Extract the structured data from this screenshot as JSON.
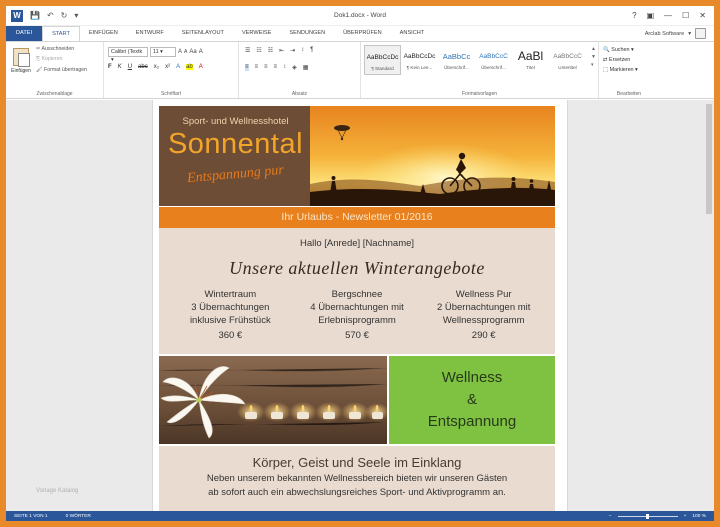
{
  "window": {
    "title": "Dok1.docx - Word",
    "controls": [
      "?",
      "▣",
      "—",
      "☐",
      "✕"
    ]
  },
  "qat": {
    "app_letter": "W",
    "save": "💾",
    "undo": "↶",
    "redo": "↻",
    "more": "▾"
  },
  "tabs": [
    "DATEI",
    "START",
    "EINFÜGEN",
    "ENTWURF",
    "SEITENLAYOUT",
    "VERWEISE",
    "SENDUNGEN",
    "ÜBERPRÜFEN",
    "ANSICHT"
  ],
  "active_tab": "START",
  "account": {
    "name": "Arclab Software",
    "caret": "▾"
  },
  "ribbon": {
    "clipboard": {
      "label": "Zwischenablage",
      "paste": "Einfügen",
      "cut": "Ausschneiden",
      "copy": "Kopieren",
      "format_painter": "Format übertragen"
    },
    "font": {
      "label": "Schriftart",
      "font_name": "Calibri (Textk ▾",
      "font_size": "11 ▾",
      "grow": "A",
      "shrink": "A",
      "case": "Aa",
      "clear": "A",
      "bold": "F",
      "italic": "K",
      "underline": "U",
      "strike": "abc",
      "sub": "x₂",
      "sup": "x²",
      "effects": "A",
      "highlight": "ab",
      "color": "A"
    },
    "paragraph": {
      "label": "Absatz",
      "bullets": "☰",
      "numbering": "☷",
      "multilevel": "☵",
      "decrease": "⇤",
      "increase": "⇥",
      "sort": "↕",
      "marks": "¶",
      "left": "≡",
      "center": "≡",
      "right": "≡",
      "justify": "≡",
      "spacing": "↕",
      "shading": "◈",
      "borders": "▦"
    },
    "styles": {
      "label": "Formatvorlagen",
      "items": [
        {
          "preview": "AaBbCcDc",
          "name": "¶ Standard"
        },
        {
          "preview": "AaBbCcDc",
          "name": "¶ Kein Lee..."
        },
        {
          "preview": "AaBbCc",
          "name": "Überschrif..."
        },
        {
          "preview": "AaBbCcC",
          "name": "Überschrif..."
        },
        {
          "preview": "AaBl",
          "name": "Titel"
        },
        {
          "preview": "AaBbCcC",
          "name": "Untertitel"
        }
      ],
      "up": "▲",
      "down": "▼",
      "more": "▾"
    },
    "editing": {
      "label": "Bearbeiten",
      "find": "Suchen ▾",
      "replace": "Ersetzen",
      "select": "Markieren ▾"
    }
  },
  "newsletter": {
    "brand_top": "Sport- und Wellnesshotel",
    "brand_name": "Sonnental",
    "brand_tagline": "Entspannung pur",
    "banner": "Ihr Urlaubs - Newsletter 01/2016",
    "greeting": "Hallo [Anrede] [Nachname]",
    "offers_title": "Unsere aktuellen Winterangebote",
    "offers": [
      {
        "name": "Wintertraum",
        "line1": "3 Übernachtungen",
        "line2": "inklusive Frühstück",
        "price": "360 €"
      },
      {
        "name": "Bergschnee",
        "line1": "4 Übernachtungen mit",
        "line2": "Erlebnisprogramm",
        "price": "570 €"
      },
      {
        "name": "Wellness Pur",
        "line1": "2 Übernachtungen mit",
        "line2": "Wellnessprogramm",
        "price": "290 €"
      }
    ],
    "wellness_line1": "Wellness",
    "wellness_line2": "&",
    "wellness_line3": "Entspannung",
    "body_title": "Körper, Geist und Seele im Einklang",
    "body_line1": "Neben unserem bekannten Wellnessbereich bieten wir unseren Gästen",
    "body_line2": "ab sofort auch ein abwechslungsreiches Sport- und Aktivprogramm an."
  },
  "watermark": "Vorlage Katalog",
  "status": {
    "page": "SEITE 1 VON 1",
    "words": "0 WÖRTER",
    "zoom_minus": "−",
    "zoom_plus": "+",
    "zoom": "100 %"
  },
  "colors": {
    "frame": "#e8892a",
    "word_blue": "#2b579a",
    "brand_brown": "#6e4d36",
    "banner_orange": "#e8811d",
    "offer_bg": "#e9dbd0",
    "wellness_green": "#7fc241"
  }
}
